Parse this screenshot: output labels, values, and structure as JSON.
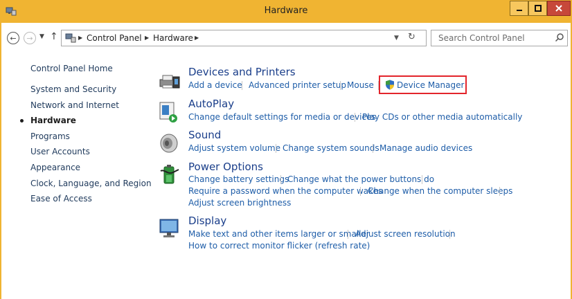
{
  "window": {
    "title": "Hardware",
    "frame_color": "#f0b432",
    "close_color": "#c7483a"
  },
  "nav": {
    "back_icon": "arrow-left-icon",
    "forward_icon": "arrow-right-icon",
    "up_icon": "arrow-up-icon"
  },
  "address": {
    "crumbs": [
      "Control Panel",
      "Hardware"
    ]
  },
  "search": {
    "placeholder": "Search Control Panel"
  },
  "sidebar": {
    "items": [
      {
        "label": "Control Panel Home",
        "active": false
      },
      {
        "label": "System and Security",
        "active": false
      },
      {
        "label": "Network and Internet",
        "active": false
      },
      {
        "label": "Hardware",
        "active": true
      },
      {
        "label": "Programs",
        "active": false
      },
      {
        "label": "User Accounts",
        "active": false
      },
      {
        "label": "Appearance",
        "active": false
      },
      {
        "label": "Clock, Language, and Region",
        "active": false
      },
      {
        "label": "Ease of Access",
        "active": false
      }
    ]
  },
  "categories": [
    {
      "title": "Devices and Printers",
      "icon": "printer-icon",
      "tasks": [
        "Add a device",
        "Advanced printer setup",
        "Mouse",
        "Device Manager"
      ]
    },
    {
      "title": "AutoPlay",
      "icon": "autoplay-icon",
      "tasks": [
        "Change default settings for media or devices",
        "Play CDs or other media automatically"
      ]
    },
    {
      "title": "Sound",
      "icon": "speaker-icon",
      "tasks": [
        "Adjust system volume",
        "Change system sounds",
        "Manage audio devices"
      ]
    },
    {
      "title": "Power Options",
      "icon": "battery-icon",
      "tasks": [
        "Change battery settings",
        "Change what the power buttons do",
        "Require a password when the computer wakes",
        "Change when the computer sleeps",
        "Adjust screen brightness"
      ]
    },
    {
      "title": "Display",
      "icon": "monitor-icon",
      "tasks": [
        "Make text and other items larger or smaller",
        "Adjust screen resolution",
        "How to correct monitor flicker (refresh rate)"
      ]
    }
  ],
  "highlight_color": "#e3242b"
}
